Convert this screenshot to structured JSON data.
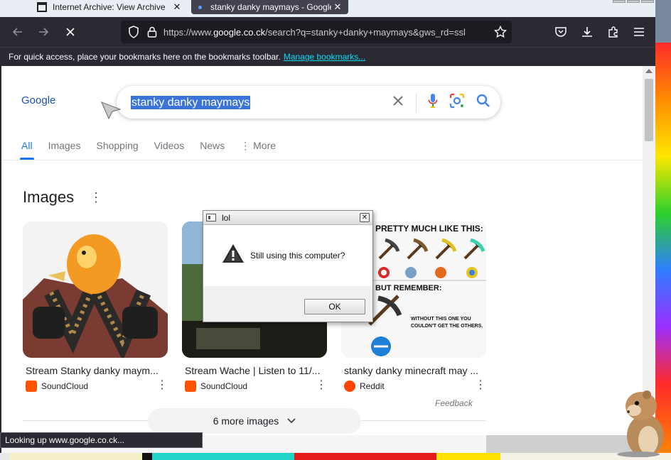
{
  "browser": {
    "tabs": [
      {
        "title": "Internet Archive: View Archive",
        "active": false
      },
      {
        "title": "stanky danky maymays - Google",
        "active": true
      }
    ],
    "url": {
      "scheme": "https://www.",
      "host": "google.co.ck",
      "path": "/search?q=stanky+danky+maymays&gws_rd=ssl"
    },
    "bookmarks_text": "For quick access, place your bookmarks here on the bookmarks toolbar.",
    "bookmarks_link": "Manage bookmarks...",
    "status_text": "Looking up www.google.co.ck..."
  },
  "google": {
    "logo": "Google",
    "query": "stanky danky maymays",
    "tabs": [
      "All",
      "Images",
      "Shopping",
      "Videos",
      "News",
      "More"
    ],
    "images_heading": "Images",
    "results": [
      {
        "title": "Stream Stanky danky maym...",
        "source": "SoundCloud"
      },
      {
        "title": "Stream Wache | Listen to 11/...",
        "source": "SoundCloud"
      },
      {
        "title": "stanky danky minecraft may ...",
        "source": "Reddit"
      }
    ],
    "meme": {
      "header": "PRETTY MUCH LIKE THIS:",
      "footer": "BUT REMEMBER:",
      "caption1": "WITHOUT THIS ONE YOU",
      "caption2": "COULDN'T GET THE OTHERS."
    },
    "feedback": "Feedback",
    "more_images": "6 more images"
  },
  "dialog": {
    "title": "lol",
    "message": "Still using this computer?",
    "ok": "OK"
  },
  "colors": {
    "accent": "#1a73e8",
    "browser_dark": "#2b2a33",
    "selection": "#3a74d8"
  }
}
